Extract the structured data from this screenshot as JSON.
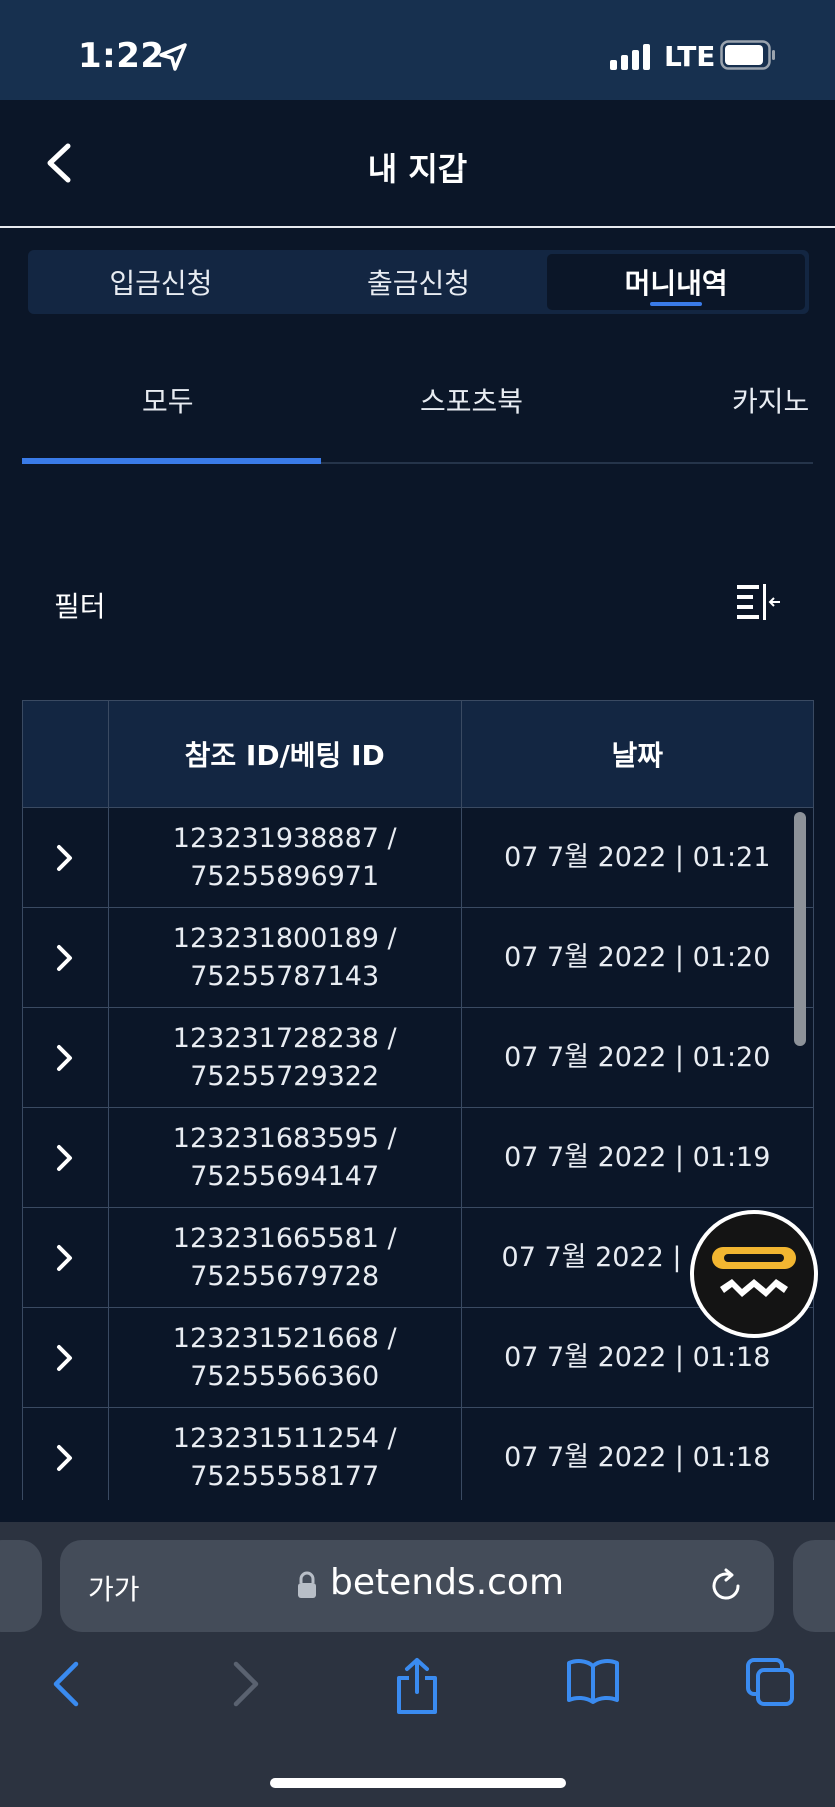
{
  "status_bar": {
    "time": "1:22",
    "network": "LTE"
  },
  "header": {
    "title": "내 지갑"
  },
  "wallet_tabs": [
    {
      "label": "입금신청",
      "active": false
    },
    {
      "label": "출금신청",
      "active": false
    },
    {
      "label": "머니내역",
      "active": true
    }
  ],
  "category_tabs": [
    {
      "label": "모두",
      "active": true
    },
    {
      "label": "스포츠북",
      "active": false
    },
    {
      "label": "카지노",
      "active": false
    }
  ],
  "filter": {
    "label": "필터"
  },
  "table": {
    "headers": {
      "expand": "",
      "ref": "참조 ID/베팅 ID",
      "date": "날짜"
    },
    "rows": [
      {
        "ref_id": "123231938887 /",
        "bet_id": "75255896971",
        "date": "07 7월 2022 | 01:21"
      },
      {
        "ref_id": "123231800189 /",
        "bet_id": "75255787143",
        "date": "07 7월 2022 | 01:20"
      },
      {
        "ref_id": "123231728238 /",
        "bet_id": "75255729322",
        "date": "07 7월 2022 | 01:20"
      },
      {
        "ref_id": "123231683595 /",
        "bet_id": "75255694147",
        "date": "07 7월 2022 | 01:19"
      },
      {
        "ref_id": "123231665581 /",
        "bet_id": "75255679728",
        "date": "07 7월 2022 |"
      },
      {
        "ref_id": "123231521668 /",
        "bet_id": "75255566360",
        "date": "07 7월 2022 | 01:18"
      },
      {
        "ref_id": "123231511254 /",
        "bet_id": "75255558177",
        "date": "07 7월 2022 | 01:18"
      }
    ]
  },
  "browser": {
    "text_size_label": "가가",
    "url": "betends.com"
  },
  "colors": {
    "background": "#0b1628",
    "status_bar": "#17304f",
    "accent": "#3a7be8",
    "fab_yellow": "#f2b631"
  }
}
